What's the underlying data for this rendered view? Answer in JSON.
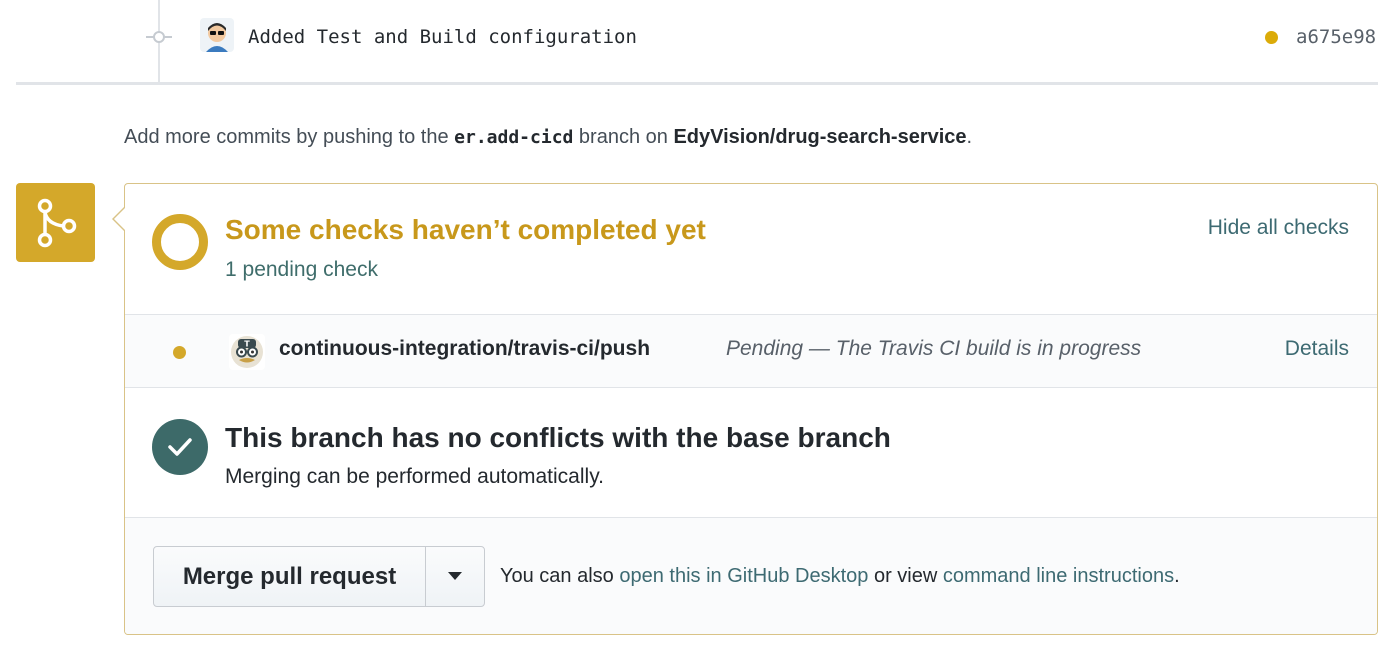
{
  "commit": {
    "message": "Added Test and Build configuration",
    "sha": "a675e98",
    "status_color": "#dbab09"
  },
  "push_hint": {
    "prefix": "Add more commits by pushing to the ",
    "branch": "er.add-cicd",
    "middle": " branch on ",
    "repo": "EdyVision/drug-search-service",
    "suffix": "."
  },
  "checks": {
    "title": "Some checks haven’t completed yet",
    "subtitle": "1 pending check",
    "toggle_label": "Hide all checks",
    "status_color": "#d4a82a",
    "items": [
      {
        "context": "continuous-integration/travis-ci/push",
        "description": "Pending — The Travis CI build is in progress",
        "details_label": "Details"
      }
    ]
  },
  "conflicts": {
    "title": "This branch has no conflicts with the base branch",
    "subtitle": "Merging can be performed automatically.",
    "status_color": "#3d6a69"
  },
  "merge": {
    "button_label": "Merge pull request",
    "hint_prefix": "You can also ",
    "desktop_link": "open this in GitHub Desktop",
    "hint_middle": " or view ",
    "cli_link": "command line instructions",
    "hint_suffix": "."
  },
  "icons": {
    "commit": "git-commit-icon",
    "merge": "git-merge-icon",
    "success": "check-icon",
    "dropdown": "triangle-down-icon"
  }
}
